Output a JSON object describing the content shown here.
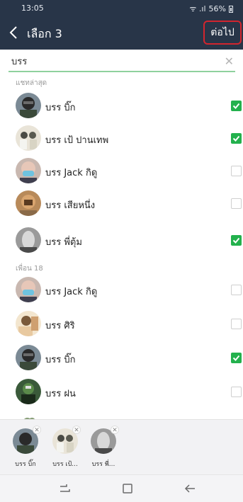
{
  "status": {
    "time": "13:05",
    "signal": "ᯤ .ıl",
    "battery": "56%"
  },
  "header": {
    "title": "เลือก 3",
    "next_label": "ต่อไป"
  },
  "search": {
    "value": "บรร",
    "placeholder": ""
  },
  "sections": {
    "recent": "แชทล่าสุด",
    "friends": "เพื่อน 18"
  },
  "rows": [
    {
      "name": "บรร บิ๊ก",
      "checked": true
    },
    {
      "name": "บรร เป้ ปานเทพ",
      "checked": true
    },
    {
      "name": "บรร Jack กิดู",
      "checked": false
    },
    {
      "name": "บรร เสียหนึ่ง",
      "checked": false
    },
    {
      "name": "บรร พี่ตุ้ม",
      "checked": true
    },
    {
      "name": "บรร Jack กิดู",
      "checked": false
    },
    {
      "name": "บรร ศิริ",
      "checked": false
    },
    {
      "name": "บรร บิ๊ก",
      "checked": true
    },
    {
      "name": "บรร ฝน",
      "checked": false
    }
  ],
  "selected": [
    {
      "label": "บรร บิ๊ก"
    },
    {
      "label": "บรร เป้..."
    },
    {
      "label": "บรร พี่..."
    }
  ],
  "colors": {
    "header_bg": "#283548",
    "check_green": "#23b14d",
    "highlight_red": "#d2252e"
  }
}
